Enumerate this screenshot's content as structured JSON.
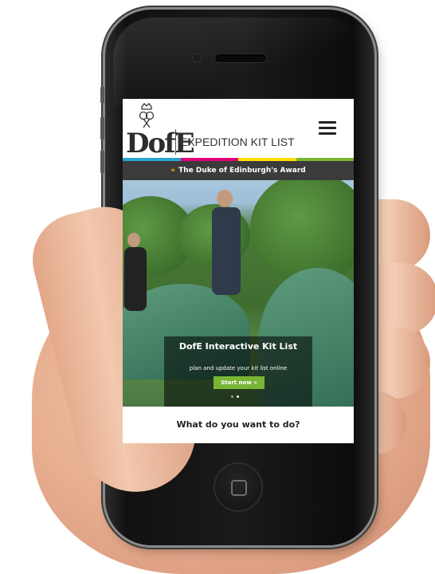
{
  "site": {
    "logo_text": "DofE",
    "title": "EXPEDITION KIT LIST",
    "award_bar": "The Duke of Edinburgh's Award",
    "award_bar_arrow": "»"
  },
  "hero": {
    "title": "DofE Interactive Kit List",
    "subtitle": "plan and update your kit list online",
    "cta_label": "Start now",
    "cta_arrow": "»",
    "slides_total": 2,
    "slide_active": 2
  },
  "main": {
    "question": "What do you want to do?"
  },
  "colors": {
    "cta_green": "#7ab435",
    "award_bar_bg": "#3b3b3b",
    "award_arrow": "#e8c400",
    "stripe": [
      "#2aa5d6",
      "#e2007a",
      "#ffde00",
      "#7ab435"
    ]
  },
  "icons": {
    "menu": "hamburger-icon",
    "crest": "crest-icon",
    "home": "home-button-icon"
  }
}
